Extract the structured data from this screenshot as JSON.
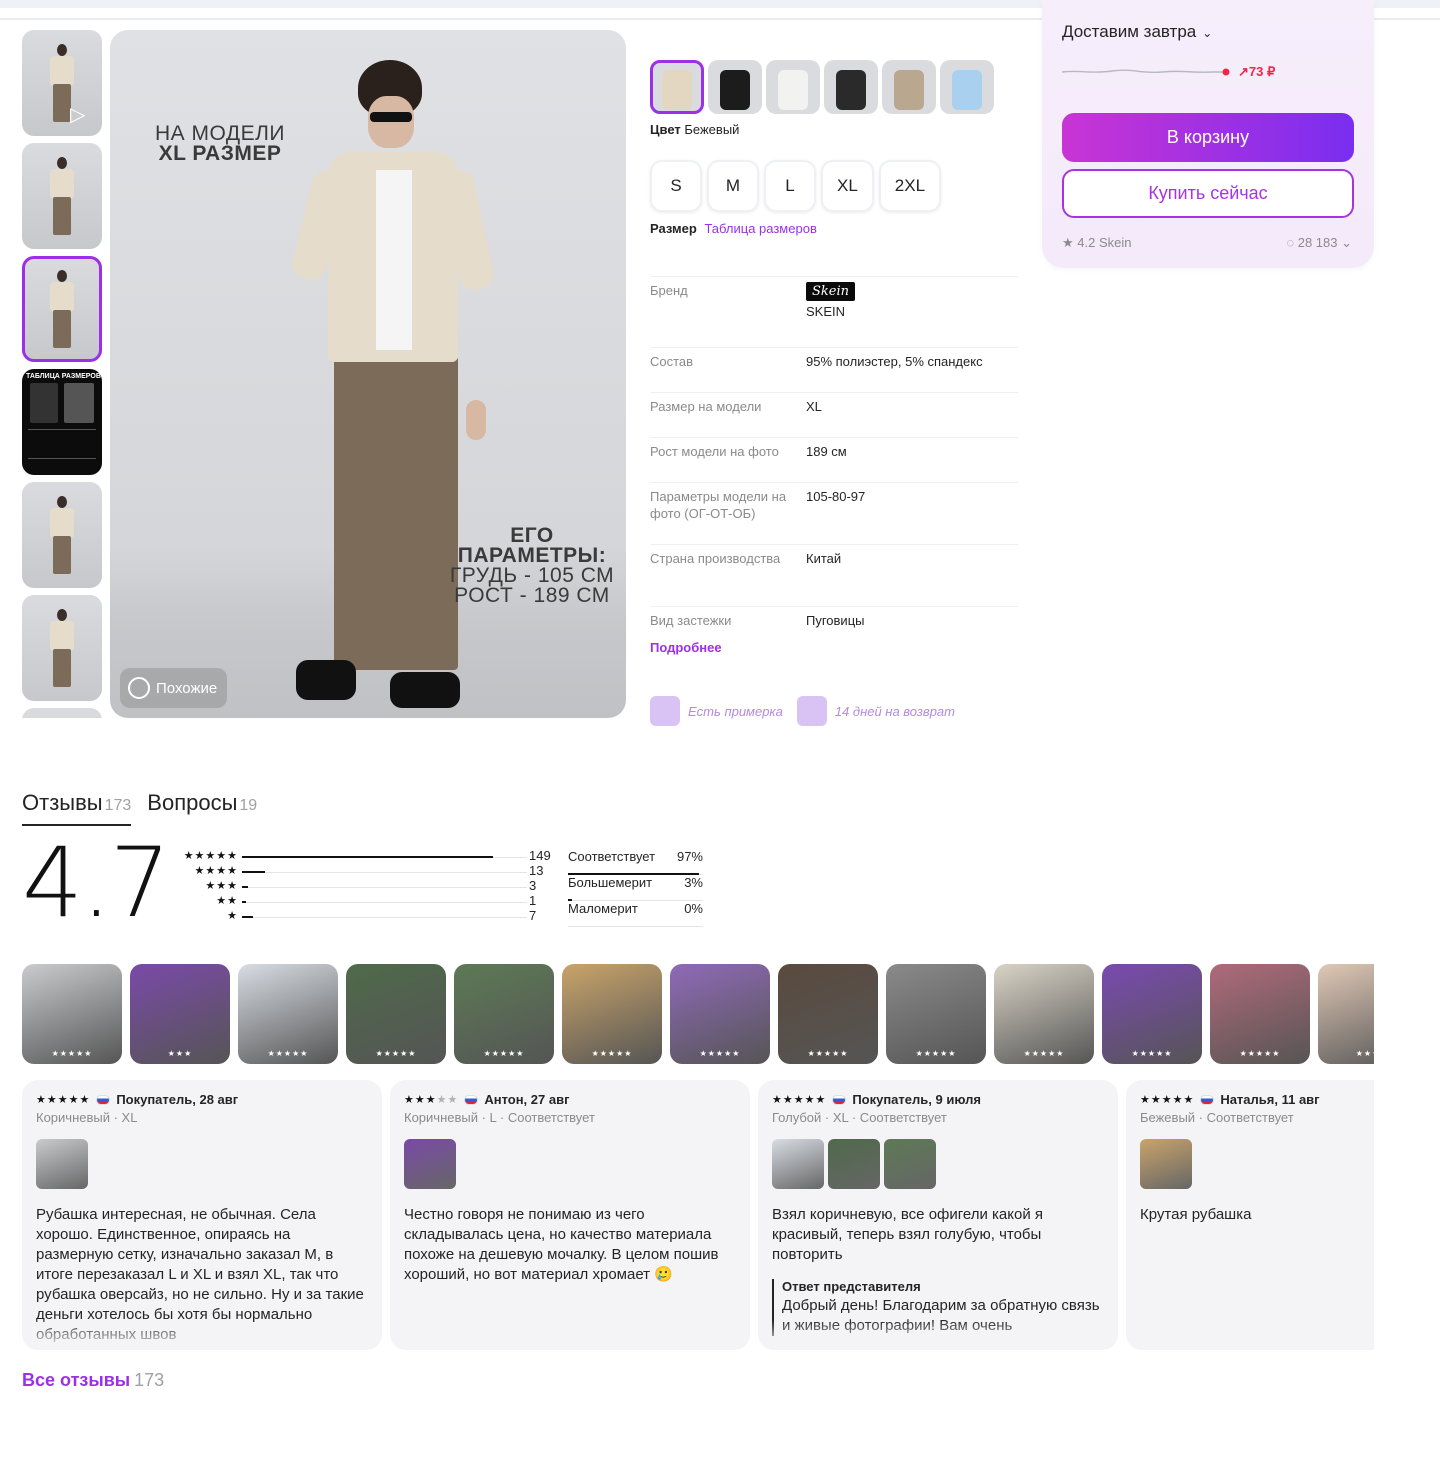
{
  "gallery": {
    "thumb_count": 7,
    "active_thumb": 2,
    "main_left_text_1": "НА МОДЕЛИ",
    "main_left_text_2": "XL РАЗМЕР",
    "main_right_text_1": "ЕГО",
    "main_right_text_2": "ПАРАМЕТРЫ:",
    "main_right_text_3": "ГРУДЬ - 105 СМ",
    "main_right_text_4": "РОСТ - 189 СМ",
    "table_thumb_title": "ТАБЛИЦА РАЗМЕРОВ",
    "similar_label": "Похожие"
  },
  "product": {
    "colors": [
      {
        "name": "beige",
        "hex": "#e3d7c2"
      },
      {
        "name": "black",
        "hex": "#1c1c1c"
      },
      {
        "name": "white",
        "hex": "#f2f2f0"
      },
      {
        "name": "black-2",
        "hex": "#2a2a2a"
      },
      {
        "name": "khaki",
        "hex": "#b9a88f"
      },
      {
        "name": "light-blue",
        "hex": "#a9d0ef"
      }
    ],
    "color_label": "Цвет",
    "color_value": "Бежевый",
    "sizes": [
      "S",
      "M",
      "L",
      "XL",
      "2XL"
    ],
    "size_label": "Размер",
    "size_table_link": "Таблица размеров",
    "specs": [
      {
        "key": "Бренд",
        "value": "SKEIN",
        "logo": "Skein"
      },
      {
        "key": "Состав",
        "value": "95% полиэстер, 5% спандекс"
      },
      {
        "key": "Размер на модели",
        "value": "XL"
      },
      {
        "key": "Рост модели на фото",
        "value": "189 см"
      },
      {
        "key": "Параметры модели на фото (ОГ-ОТ-ОБ)",
        "value": "105-80-97"
      },
      {
        "key": "Страна производства",
        "value": "Китай"
      },
      {
        "key": "Вид застежки",
        "value": "Пуговицы"
      }
    ],
    "more_link": "Подробнее",
    "perk_fitting": "Есть примерка",
    "perk_return": "14 дней на возврат"
  },
  "buybox": {
    "delivery": "Доставим завтра",
    "price_trend": "73 ₽",
    "cart_button": "В корзину",
    "buy_now_button": "Купить сейчас",
    "seller": "4.2 Skein",
    "seller_reviews": "28 183",
    "colors": {
      "accent": "#9b30e8",
      "trend": "#f2264a"
    }
  },
  "reviews": {
    "tab_reviews": "Отзывы",
    "tab_reviews_count": "173",
    "tab_questions": "Вопросы",
    "tab_questions_count": "19",
    "rating": "4.7",
    "distribution": [
      {
        "stars": "★★★★★",
        "count": "149",
        "fraction": 0.88
      },
      {
        "stars": "★★★★",
        "count": "13",
        "fraction": 0.08
      },
      {
        "stars": "★★★",
        "count": "3",
        "fraction": 0.02
      },
      {
        "stars": "★★",
        "count": "1",
        "fraction": 0.01
      },
      {
        "stars": "★",
        "count": "7",
        "fraction": 0.04
      }
    ],
    "fit": [
      {
        "label": "Соответствует",
        "value": "97%",
        "fraction": 0.97
      },
      {
        "label": "Большемерит",
        "value": "3%",
        "fraction": 0.03
      },
      {
        "label": "Маломерит",
        "value": "0%",
        "fraction": 0.0
      }
    ],
    "photos": [
      {
        "bg": "#c9cbce",
        "stars": "★★★★★"
      },
      {
        "bg": "#7a4aa8",
        "stars": "★★★"
      },
      {
        "bg": "#d8dde4",
        "stars": "★★★★★"
      },
      {
        "bg": "#4f6a4a",
        "stars": "★★★★★"
      },
      {
        "bg": "#5d7a55",
        "stars": "★★★★★"
      },
      {
        "bg": "#c9a46a",
        "stars": "★★★★★"
      },
      {
        "bg": "#8f6ab8",
        "stars": "★★★★★"
      },
      {
        "bg": "#5a4a3e",
        "stars": "★★★★★"
      },
      {
        "bg": "#8a8a8a",
        "stars": "★★★★★"
      },
      {
        "bg": "#d9d3c6",
        "stars": "★★★★★"
      },
      {
        "bg": "#7a4ab0",
        "stars": "★★★★★"
      },
      {
        "bg": "#b06a7a",
        "stars": "★★★★★"
      },
      {
        "bg": "#e0c8b6",
        "stars": "★★★"
      }
    ],
    "cards": [
      {
        "stars_on": "★★★★★",
        "stars_off": "",
        "author": "Покупатель, 28 авг",
        "meta": "Коричневый · XL",
        "images": [
          "#c9cbce"
        ],
        "text": "Рубашка интересная, не обычная. Села хорошо. Единственное, опираясь на размерную сетку, изначально заказал М, в итоге перезаказал L и XL и взял XL, так что рубашка оверсайз, но не сильно. Ну и за такие деньги хотелось бы хотя бы нормально обработанных швов",
        "answer_title": "",
        "answer_text": ""
      },
      {
        "stars_on": "★★★",
        "stars_off": "★★",
        "author": "Антон, 27 авг",
        "meta": "Коричневый · L · Соответствует",
        "images": [
          "#7a4aa8"
        ],
        "text": "Честно говоря не понимаю из чего складывалась цена, но качество материала похоже на дешевую мочалку. В целом пошив хороший, но вот материал хромает 🥲",
        "answer_title": "",
        "answer_text": ""
      },
      {
        "stars_on": "★★★★★",
        "stars_off": "",
        "author": "Покупатель, 9 июля",
        "meta": "Голубой · XL · Соответствует",
        "images": [
          "#d8dde4",
          "#4f6a4a",
          "#5d7a55"
        ],
        "text": "Взял коричневую, все офигели какой я красивый, теперь взял голубую, чтобы повторить",
        "answer_title": "Ответ представителя",
        "answer_text": "Добрый день! Благодарим за обратную связь и живые фотографии! Вам очень"
      },
      {
        "stars_on": "★★★★★",
        "stars_off": "",
        "author": "Наталья, 11 авг",
        "meta": "Бежевый · Соответствует",
        "images": [
          "#c9a46a"
        ],
        "text": "Крутая рубашка",
        "answer_title": "",
        "answer_text": ""
      }
    ],
    "all_reviews": "Все отзывы",
    "all_reviews_count": "173"
  }
}
